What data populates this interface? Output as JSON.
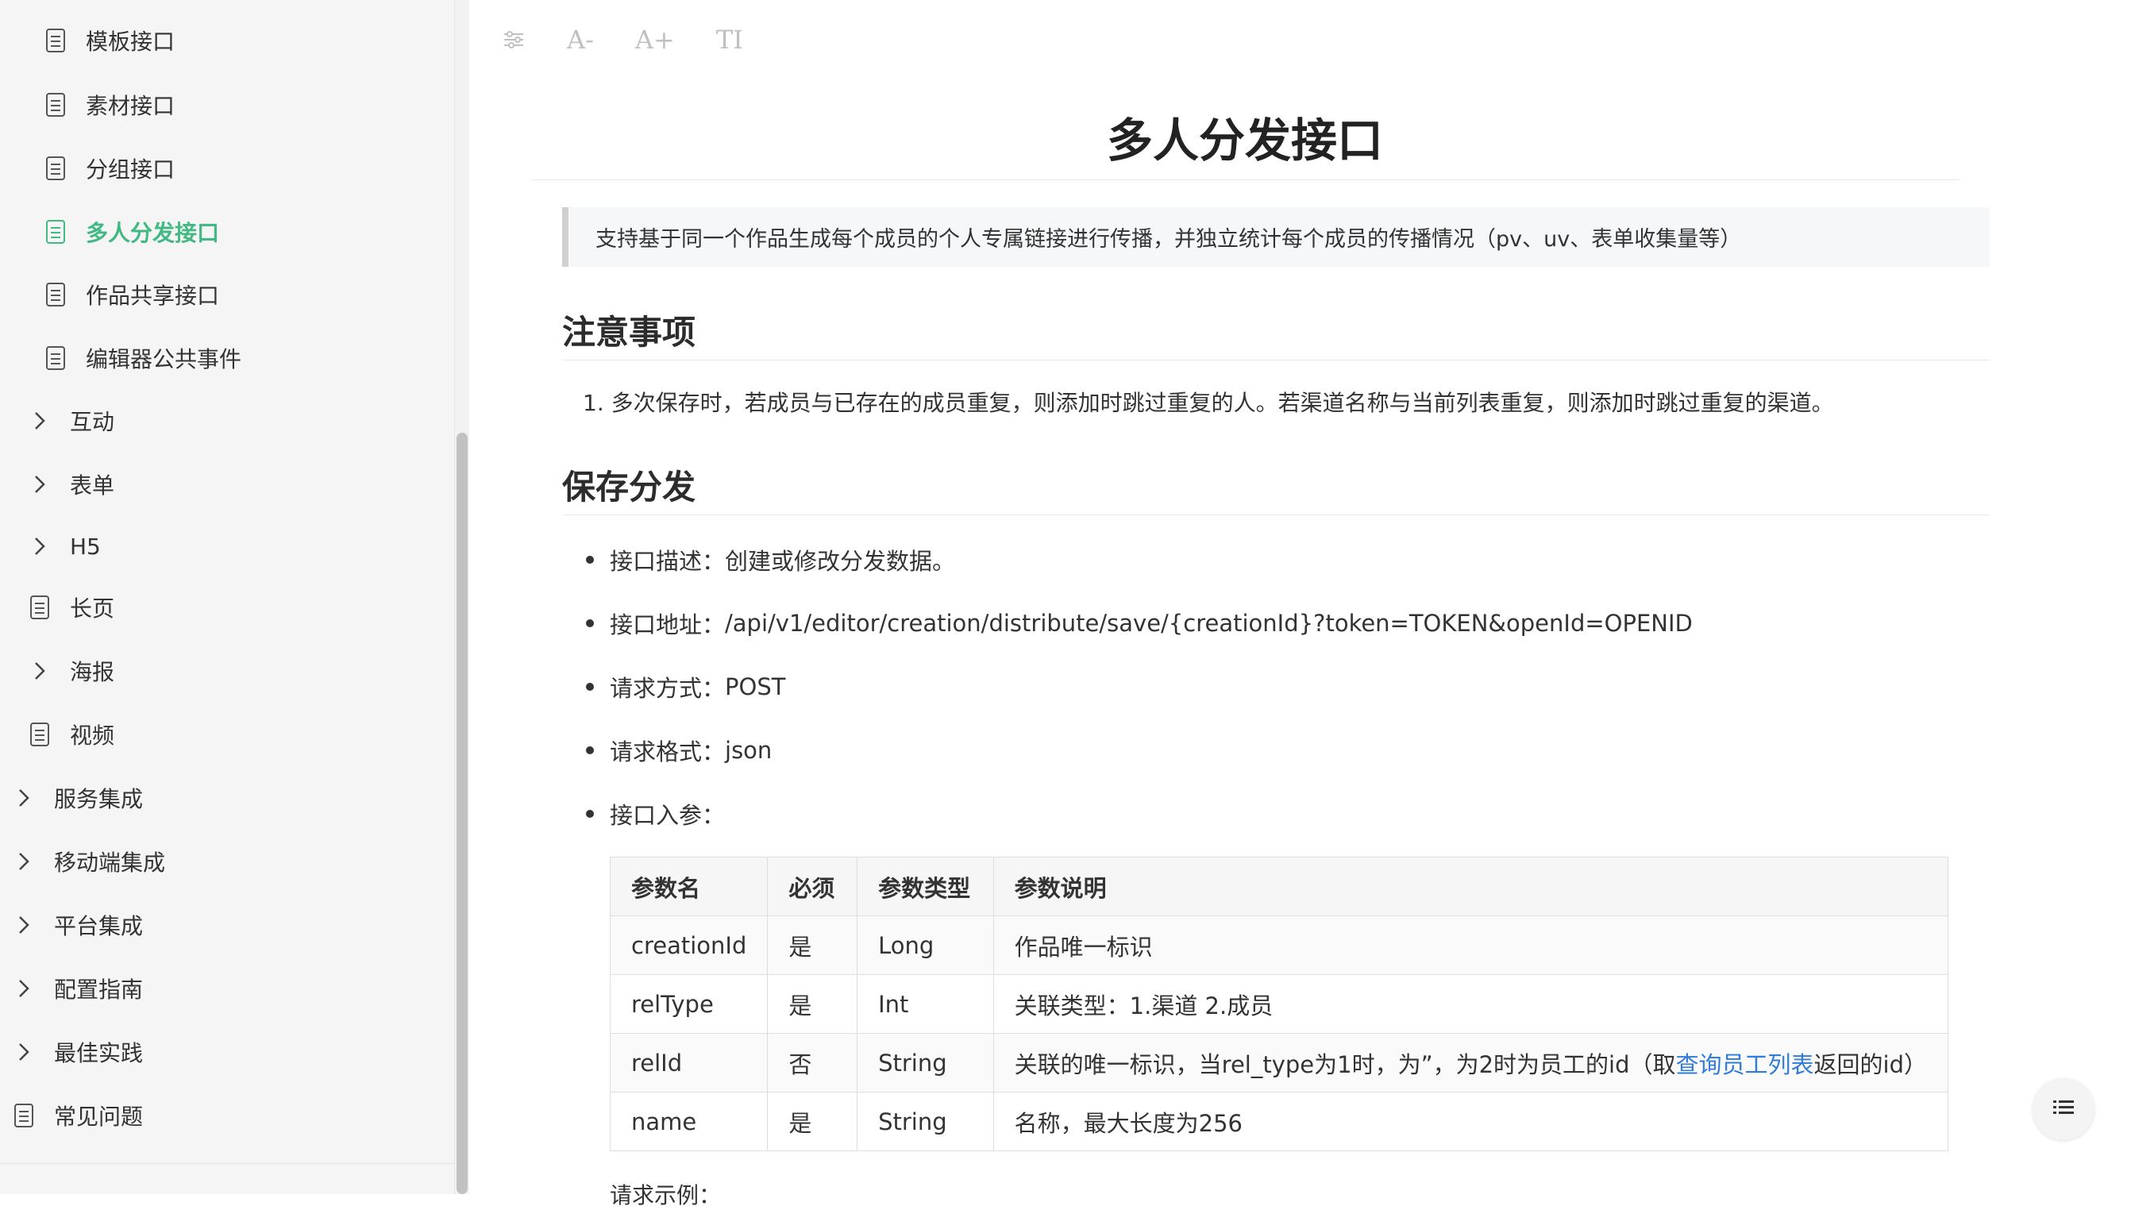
{
  "sidebar": {
    "items": [
      {
        "label": "模板接口",
        "type": "doc",
        "active": false
      },
      {
        "label": "素材接口",
        "type": "doc",
        "active": false
      },
      {
        "label": "分组接口",
        "type": "doc",
        "active": false
      },
      {
        "label": "多人分发接口",
        "type": "doc",
        "active": true
      },
      {
        "label": "作品共享接口",
        "type": "doc",
        "active": false
      },
      {
        "label": "编辑器公共事件",
        "type": "doc",
        "active": false
      },
      {
        "label": "互动",
        "type": "folder",
        "active": false
      },
      {
        "label": "表单",
        "type": "folder",
        "active": false
      },
      {
        "label": "H5",
        "type": "folder",
        "active": false
      },
      {
        "label": "长页",
        "type": "doc",
        "active": false
      },
      {
        "label": "海报",
        "type": "folder",
        "active": false
      },
      {
        "label": "视频",
        "type": "doc",
        "active": false
      },
      {
        "label": "服务集成",
        "type": "folder",
        "active": false
      },
      {
        "label": "移动端集成",
        "type": "folder",
        "active": false
      },
      {
        "label": "平台集成",
        "type": "folder",
        "active": false
      },
      {
        "label": "配置指南",
        "type": "folder",
        "active": false
      },
      {
        "label": "最佳实践",
        "type": "folder",
        "active": false
      },
      {
        "label": "常见问题",
        "type": "doc",
        "active": false
      }
    ]
  },
  "toolbar": {
    "settings_icon": "sliders-icon",
    "font_decrease": "A-",
    "font_increase": "A+",
    "font_toggle": "TI"
  },
  "content": {
    "title": "多人分发接口",
    "tip": "支持基于同一个作品生成每个成员的个人专属链接进行传播，并独立统计每个成员的传播情况（pv、uv、表单收集量等）",
    "notes_heading": "注意事项",
    "notes": [
      "1. 多次保存时，若成员与已存在的成员重复，则添加时跳过重复的人。若渠道名称与当前列表重复，则添加时跳过重复的渠道。"
    ],
    "save_heading": "保存分发",
    "bullets": [
      {
        "label": "接口描述：",
        "value": "创建或修改分发数据。"
      },
      {
        "label": "接口地址：",
        "value": "/api/v1/editor/creation/distribute/save/{creationId}?token=TOKEN&openId=OPENID"
      },
      {
        "label": "请求方式：",
        "value": "POST"
      },
      {
        "label": "请求格式：",
        "value": "json"
      },
      {
        "label": "接口入参：",
        "value": ""
      }
    ],
    "table": {
      "headers": [
        "参数名",
        "必须",
        "参数类型",
        "参数说明"
      ],
      "rows": [
        [
          "creationId",
          "是",
          "Long",
          "作品唯一标识"
        ],
        [
          "relType",
          "是",
          "Int",
          "关联类型：1.渠道 2.成员"
        ],
        [
          "relId",
          "否",
          "String",
          "关联的唯一标识，当rel_type为1时，为”，为2时为员工的id（取",
          "查询员工列表",
          "返回的id）"
        ],
        [
          "name",
          "是",
          "String",
          "名称，最大长度为256"
        ]
      ]
    },
    "cut_text": "请求示例："
  },
  "toc_icon": "list-icon",
  "colors": {
    "accent": "#42b983",
    "link": "#2e7cdc"
  }
}
